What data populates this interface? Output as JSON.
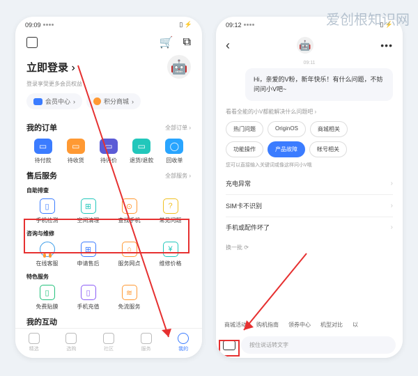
{
  "watermark": "爱创根知识网",
  "phone1": {
    "status": {
      "time": "09:09",
      "right": "⬚ ⏻"
    },
    "login": {
      "title": "立即登录",
      "arrow": "›",
      "subtitle": "登录享受更多会员权益"
    },
    "pills": {
      "member_center": "会员中心",
      "member_arrow": "›",
      "points_mall": "积分商城",
      "points_arrow": "›"
    },
    "orders": {
      "title": "我的订单",
      "link": "全部订单 ›",
      "items": [
        {
          "label": "待付款"
        },
        {
          "label": "待收货"
        },
        {
          "label": "待评价"
        },
        {
          "label": "退货/退款"
        },
        {
          "label": "回收单"
        }
      ]
    },
    "aftersales": {
      "title": "售后服务",
      "link": "全部服务 ›",
      "self_check_title": "自助排查",
      "self_check": [
        {
          "label": "手机检测"
        },
        {
          "label": "空间清理"
        },
        {
          "label": "查找手机"
        },
        {
          "label": "常见问题"
        }
      ],
      "consult_title": "咨询与维修",
      "consult": [
        {
          "label": "在线客服"
        },
        {
          "label": "申请售后"
        },
        {
          "label": "服务网点"
        },
        {
          "label": "维修价格"
        }
      ],
      "special_title": "特色服务",
      "special": [
        {
          "label": "免费贴膜"
        },
        {
          "label": "手机充值"
        },
        {
          "label": "免流服务"
        }
      ]
    },
    "interact": {
      "title": "我的互动"
    },
    "nav": [
      {
        "label": "精选"
      },
      {
        "label": "选购"
      },
      {
        "label": "社区"
      },
      {
        "label": "服务"
      },
      {
        "label": "我的"
      }
    ]
  },
  "phone2": {
    "status": {
      "time": "09:12"
    },
    "chat_time": "09:11",
    "greeting": "Hi，亲爱的V粉，新年快乐！有什么问题，不妨问问小V吧~",
    "help_prompt": "看看全能的小V都能解决什么问题吧 ›",
    "chips": [
      {
        "label": "热门问题"
      },
      {
        "label": "OriginOS"
      },
      {
        "label": "商城相关"
      },
      {
        "label": "功能操作"
      },
      {
        "label": "产品故障",
        "active": true
      },
      {
        "label": "帐号相关"
      }
    ],
    "chip_hint": "您可以直接输入关键词或像这样问小V哦",
    "faq": [
      {
        "label": "充电异常"
      },
      {
        "label": "SIM卡不识别"
      },
      {
        "label": "手机或配件坏了"
      }
    ],
    "refresh": "换一批 ⟳",
    "categories": [
      "商城活动",
      "购机指南",
      "领券中心",
      "机型对比",
      "以"
    ],
    "voice_input": "按住说话转文字"
  }
}
